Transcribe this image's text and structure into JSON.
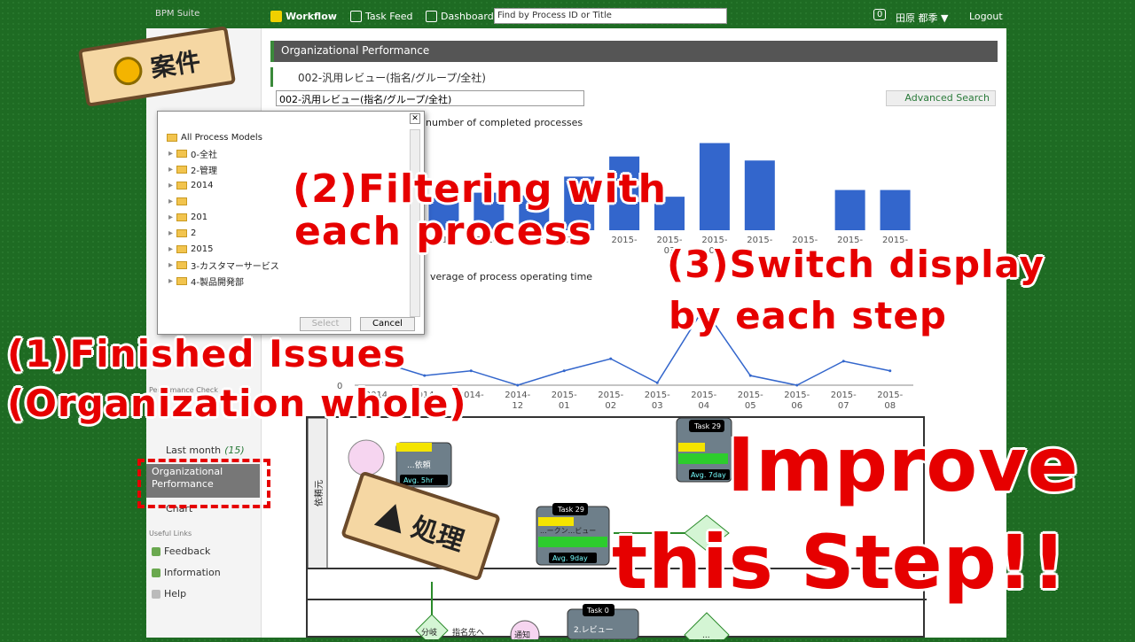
{
  "topbar": {
    "logo": "BPM Suite",
    "nav": [
      {
        "label": "Workflow",
        "icon": "check-icon"
      },
      {
        "label": "Task Feed",
        "icon": "speech-bubble-icon"
      },
      {
        "label": "Dashboard",
        "icon": "dashboard-icon"
      }
    ],
    "search_value": "Find by Process ID or Title",
    "counter": "0",
    "user": "田原 都季 ▼",
    "logout": "Logout"
  },
  "sidebar": {
    "section_perf": "Performance Check",
    "items_perf": [
      {
        "label": "Last month",
        "count": "(15)"
      },
      {
        "label": "Organizational Performance"
      },
      {
        "label": "Chart"
      }
    ],
    "section_links": "Useful Links",
    "links": [
      {
        "label": "Feedback"
      },
      {
        "label": "Information"
      },
      {
        "label": "Help"
      }
    ]
  },
  "main": {
    "title": "Organizational Performance",
    "process_title": "002-汎用レビュー(指名/グループ/全社)",
    "select_value": "002-汎用レビュー(指名/グループ/全社)",
    "advanced_search": "Advanced Search"
  },
  "dialog": {
    "tree": [
      {
        "label": "All Process Models",
        "root": true
      },
      {
        "label": "0-全社"
      },
      {
        "label": "2-管理"
      },
      {
        "label": "2014"
      },
      {
        "label": ""
      },
      {
        "label": "201"
      },
      {
        "label": "2"
      },
      {
        "label": "2015"
      },
      {
        "label": "3-カスタマーサービス"
      },
      {
        "label": "4-製品開発部"
      }
    ],
    "select_button": "Select",
    "cancel_button": "Cancel"
  },
  "chart_data": [
    {
      "type": "bar",
      "title": "number of completed processes",
      "categories": [
        "2014-",
        "2014-",
        "2014-",
        "2015-",
        "2015-",
        "2015-\n03",
        "2015-\n04",
        "2015-",
        "2015-",
        "2015-",
        "2015-"
      ],
      "values": [
        2.4,
        2.8,
        2.6,
        4.0,
        5.5,
        2.5,
        6.5,
        5.2,
        0.0,
        3.0,
        3.0
      ],
      "ylim": [
        0,
        7
      ],
      "color": "#3366cc"
    },
    {
      "type": "line",
      "title": "verage of process operating time",
      "categories": [
        "2014-",
        "2014-",
        "2014-",
        "2014-\n12",
        "2015-\n01",
        "2015-\n02",
        "2015-\n03",
        "2015-\n04",
        "2015-\n05",
        "2015-\n06",
        "2015-\n07",
        "2015-\n08"
      ],
      "values": [
        1.0,
        0.4,
        0.6,
        0.0,
        0.6,
        1.1,
        0.1,
        3.2,
        0.4,
        0.0,
        1.0,
        0.6
      ],
      "ylim": [
        0,
        3.5
      ],
      "y_tick_label": "0",
      "color": "#3366cc"
    }
  ],
  "process_map": {
    "lanes": [
      {
        "label": "依頼元"
      }
    ],
    "tasks": [
      {
        "badge": "",
        "label": "...依頼",
        "avg": "Avg. 5hr",
        "colors": [
          "#f4e400",
          "#2dcc2d"
        ]
      },
      {
        "badge": "Task 29",
        "label": "",
        "avg": "Avg. 7day",
        "colors": [
          "#f4e400",
          "#2dcc2d"
        ]
      },
      {
        "badge": "Task 29",
        "label": "...ークン...ビュー",
        "avg": "Avg. 9day",
        "colors": [
          "#f4e400",
          "#2dcc2d"
        ]
      },
      {
        "badge": "Task 0",
        "label": "2.レビュー",
        "avg": "",
        "colors": []
      }
    ],
    "nodes": [
      {
        "label": "分岐"
      },
      {
        "label": "指名先へ"
      },
      {
        "label": "通知"
      },
      {
        "label": "..."
      }
    ]
  },
  "overlays": {
    "sign_anken": "案件",
    "sign_shori": "処理",
    "label1_line1": "(1)Finished Issues",
    "label1_line2": "(Organization whole)",
    "label2_line1": "(2)Filtering with",
    "label2_line2": "each process",
    "label3_line1": "(3)Switch display",
    "label3_line2": "by each step",
    "improve_line1": "Improve",
    "improve_line2": "this Step!!"
  }
}
